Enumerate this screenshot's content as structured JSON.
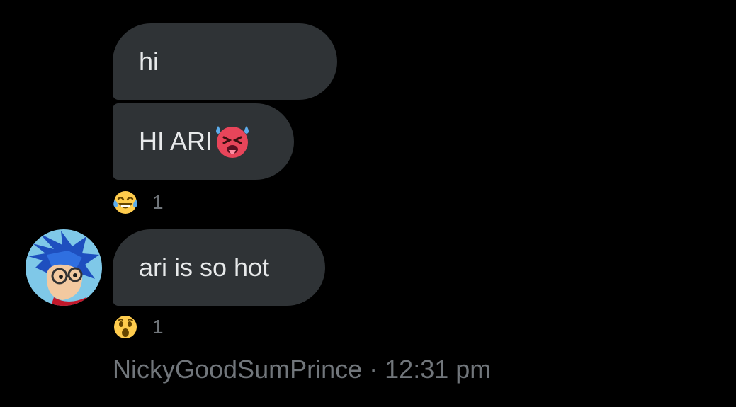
{
  "messages": [
    {
      "text": "hi"
    },
    {
      "text": "HI ARI",
      "emoji": "hot-face-emoji"
    },
    {
      "text": "ari is so hot"
    }
  ],
  "reactions": [
    {
      "emoji": "joy-laughing-emoji",
      "count": "1"
    },
    {
      "emoji": "astonished-face-emoji",
      "count": "1"
    }
  ],
  "footer": {
    "sender": "NickyGoodSumPrince",
    "separator": "·",
    "time": "12:31 pm"
  },
  "colors": {
    "background": "#000000",
    "bubble": "#2f3336",
    "text": "#e7e9ea",
    "muted": "#71767b"
  }
}
